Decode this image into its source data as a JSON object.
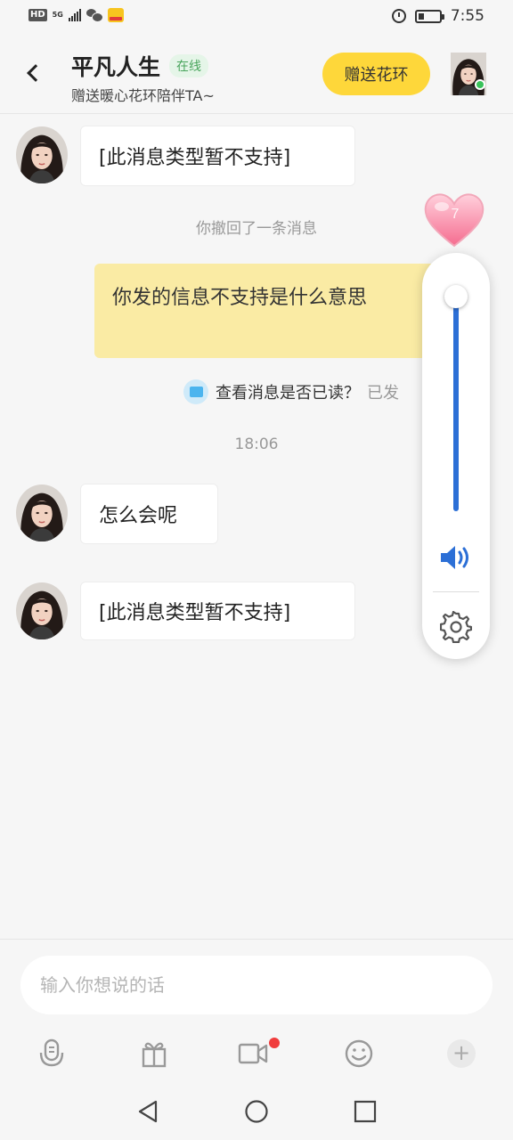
{
  "status_bar": {
    "hd": "HD",
    "network": "5G",
    "time": "7:55",
    "icons": [
      "signal-icon",
      "wechat-icon",
      "app-notification-icon",
      "alarm-icon",
      "battery-icon"
    ]
  },
  "header": {
    "name": "平凡人生",
    "status_badge": "在线",
    "subtitle": "赠送暖心花环陪伴TA~",
    "gift_button": "赠送花环",
    "online_color": "#39c25a",
    "gift_button_color": "#fed73a"
  },
  "messages": {
    "m1": "[此消息类型暂不支持]",
    "recall": "你撤回了一条消息",
    "m2": "你发的信息不支持是什么意思",
    "read_question": "查看消息是否已读？",
    "read_status": "已发",
    "timestamp": "18:06",
    "m3": "怎么会呢",
    "m4": "[此消息类型暂不支持]"
  },
  "heart_badge": "7",
  "volume": {
    "level": 1.0,
    "accent": "#2c6fd6"
  },
  "composer": {
    "placeholder": "输入你想说的话",
    "tools": [
      "voice-icon",
      "gift-icon",
      "video-call-icon",
      "emoji-icon",
      "plus-icon"
    ],
    "plus": "+"
  },
  "outgoing_bubble_color": "#faeba4"
}
